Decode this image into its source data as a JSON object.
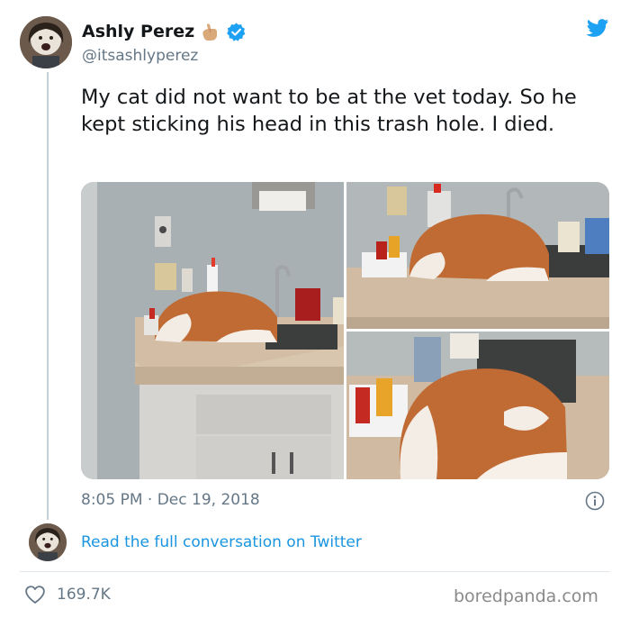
{
  "tweet": {
    "author_name": "Ashly Perez",
    "author_handle": "@itsashlyperez",
    "text": "My cat did not want to be at the vet today. So he kept sticking his head in this trash hole. I died.",
    "time": "8:05 PM",
    "separator": "·",
    "date": "Dec 19, 2018",
    "likes": "169.7K",
    "read_more": "Read the full conversation on Twitter"
  },
  "icons": {
    "brand": "twitter-bird-icon",
    "verified": "verified-badge-icon",
    "emoji": "hand-emoji-icon",
    "info": "info-icon",
    "like": "heart-icon"
  },
  "colors": {
    "twitter_blue": "#1da1f2",
    "link_blue": "#1b95e0",
    "muted": "#657786"
  },
  "watermark": "boredpanda.com"
}
